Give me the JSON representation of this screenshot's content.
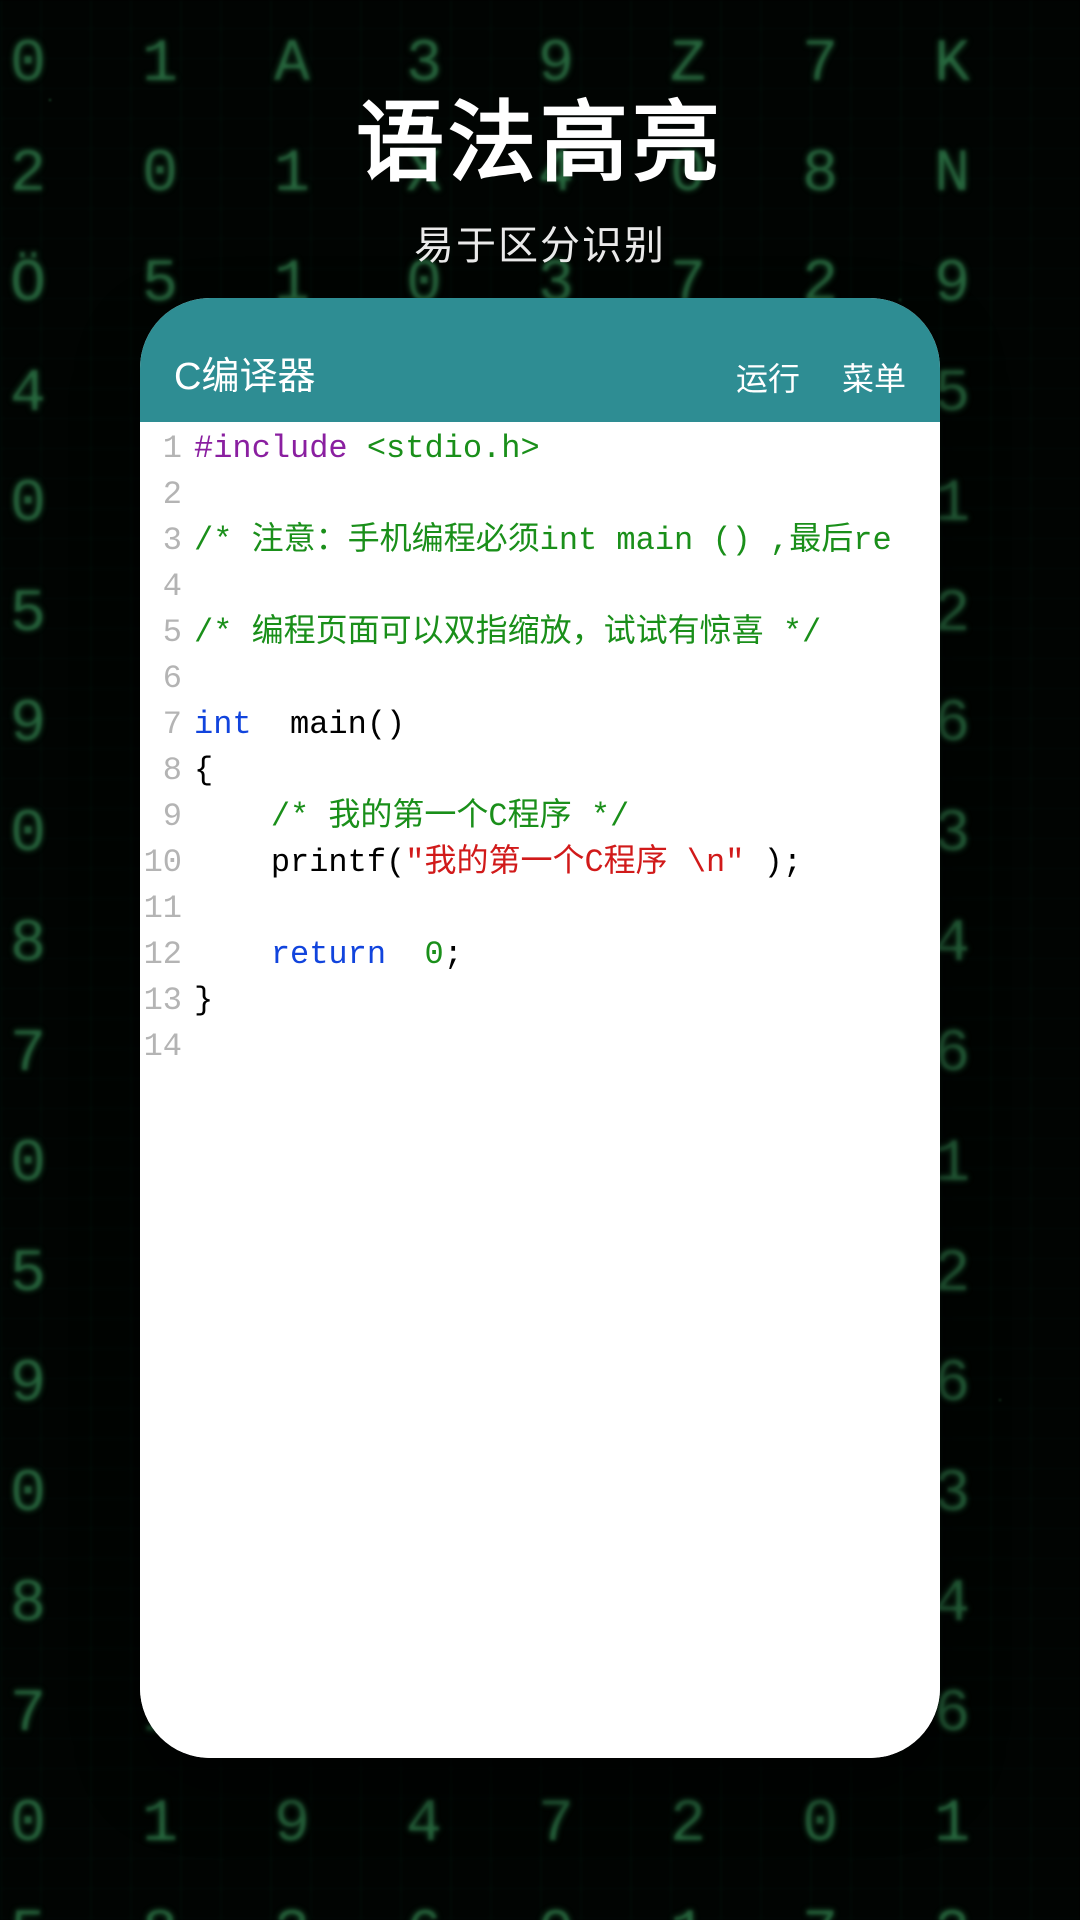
{
  "hero": {
    "title": "语法高亮",
    "subtitle": "易于区分识别"
  },
  "appbar": {
    "title": "C编译器",
    "run": "运行",
    "menu": "菜单"
  },
  "bg_glyphs": "0 1 A 3 9 Z 7 K 2 0 1 X 4 0 8 N Ö 5 1 0 3 7 2 9 4 1 0 6 3 8 2 5 0 1 9 4 7 2 0 1 5 8 3 6 0 1 7 2 9 4 0 1 3 8 5 6 0 2 9 1 4 7 0 3 8 5 1 6 2 0 9 4 7 1 0 3 8 5 2 6 0 1 9 4 7 2 0 1 5 8 3 6 0 1 7 2 9 4 0 1 3 8 5 6 0 2 9 1 4 7 0 3 8 5 1 6 2 0 9 4 7 1 0 3 8 5 2 6 0 1 9 4 7 2 0 1 5 8 3 6 0 1 7 2 9 4 0 1 3 8 5 6 0 2 9 1 4 7 0",
  "code": {
    "lines": [
      {
        "n": "1",
        "tokens": [
          {
            "c": "tok-pre",
            "t": "#include "
          },
          {
            "c": "tok-inc",
            "t": "<stdio.h>"
          }
        ]
      },
      {
        "n": "2",
        "tokens": []
      },
      {
        "n": "3",
        "tokens": [
          {
            "c": "tok-cmt",
            "t": "/* 注意：手机编程必须int main () ,最后re"
          }
        ]
      },
      {
        "n": "4",
        "tokens": []
      },
      {
        "n": "5",
        "tokens": [
          {
            "c": "tok-cmt",
            "t": "/* 编程页面可以双指缩放，试试有惊喜 */"
          }
        ]
      },
      {
        "n": "6",
        "tokens": []
      },
      {
        "n": "7",
        "tokens": [
          {
            "c": "tok-kw",
            "t": "int "
          },
          {
            "c": "tok-fn",
            "t": " main"
          },
          {
            "c": "tok-punc",
            "t": "()"
          }
        ]
      },
      {
        "n": "8",
        "tokens": [
          {
            "c": "tok-punc",
            "t": "{"
          }
        ]
      },
      {
        "n": "9",
        "tokens": [
          {
            "c": "",
            "t": "    "
          },
          {
            "c": "tok-cmt",
            "t": "/* 我的第一个C程序 */"
          }
        ]
      },
      {
        "n": "10",
        "tokens": [
          {
            "c": "",
            "t": "    "
          },
          {
            "c": "tok-fn",
            "t": "printf"
          },
          {
            "c": "tok-punc",
            "t": "("
          },
          {
            "c": "tok-str",
            "t": "\"我的第一个C程序 \\n\""
          },
          {
            "c": "tok-punc",
            "t": " );"
          }
        ]
      },
      {
        "n": "11",
        "tokens": []
      },
      {
        "n": "12",
        "tokens": [
          {
            "c": "",
            "t": "    "
          },
          {
            "c": "tok-kw",
            "t": "return "
          },
          {
            "c": "tok-num",
            "t": " 0"
          },
          {
            "c": "tok-punc",
            "t": ";"
          }
        ]
      },
      {
        "n": "13",
        "tokens": [
          {
            "c": "tok-punc",
            "t": "}"
          }
        ]
      },
      {
        "n": "14",
        "tokens": []
      }
    ]
  }
}
